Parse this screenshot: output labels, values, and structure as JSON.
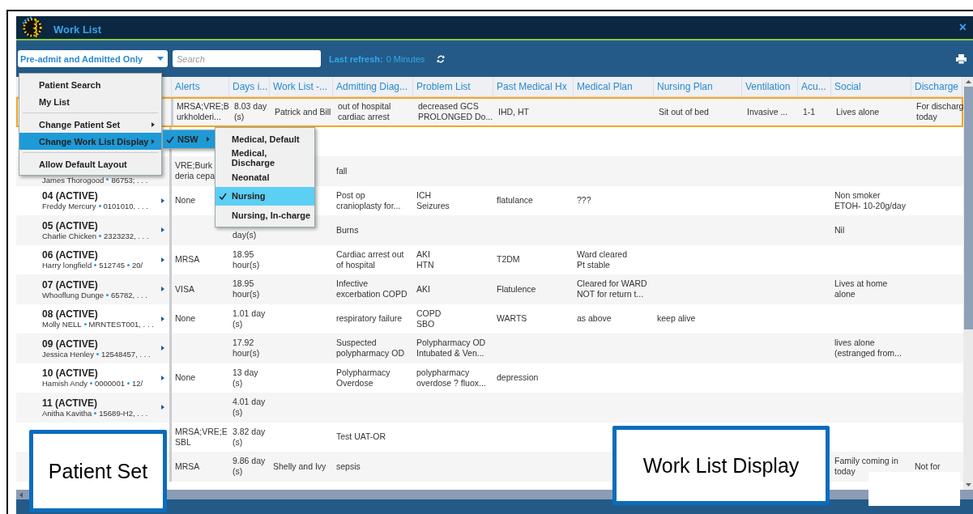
{
  "window": {
    "title": "Work List",
    "close": "×"
  },
  "toolbar": {
    "patient_filter": "Pre-admit and Admitted Only",
    "search": {
      "placeholder": "Search"
    },
    "refresh_label": "Last refresh:",
    "refresh_value": "0 Minutes"
  },
  "table": {
    "columns": [
      "Alerts",
      "Days i...",
      "Work List -...",
      "Admitting Diag...",
      "Problem List",
      "Past Medical Hx",
      "Medical Plan",
      "Nursing Plan",
      "Ventilation",
      "Acu...",
      "Social",
      "Discharge"
    ],
    "rows": [
      {
        "selected": true,
        "cells": [
          "MRSA;VRE;B\nurkholderi...",
          "8.03 day\n(s)",
          "Patrick and Bill",
          "out of hospital\ncardiac arrest",
          "decreased GCS\nPROLONGED Do...",
          "IHD, HT",
          "",
          "Sit out of bed",
          "Invasive ...",
          "1-1",
          "Lives alone",
          "For discharg\ntoday"
        ]
      },
      {
        "selected": false,
        "cells": [
          "",
          "",
          "",
          "",
          "",
          "",
          "",
          "",
          "",
          "",
          "",
          ""
        ]
      },
      {
        "selected": false,
        "patient": {
          "details": [
            "James Thorogood",
            "86753; . . ."
          ]
        },
        "cells": [
          "VRE;Burk\nderia cepa",
          "",
          "",
          "fall",
          "",
          "",
          "",
          "",
          "",
          "",
          "",
          ""
        ]
      },
      {
        "selected": false,
        "arrow": true,
        "patient": {
          "title": "04 (ACTIVE)",
          "details": [
            "Freddy Mercury",
            "0101010, . . ."
          ]
        },
        "cells": [
          "None",
          "",
          "",
          "Post op\ncranioplasty for...",
          "ICH\nSeizures",
          "flatulance",
          "???",
          "",
          "",
          "",
          "Non smoker\nETOH- 10-20g/day",
          ""
        ]
      },
      {
        "selected": false,
        "arrow": true,
        "patient": {
          "title": "05 (ACTIVE)",
          "details": [
            "Charlie Chicken",
            "2323232, . . ."
          ]
        },
        "cells": [
          "",
          "\nday(s)",
          "",
          "Burns",
          "",
          "",
          "",
          "",
          "",
          "",
          "Nil",
          ""
        ]
      },
      {
        "selected": false,
        "arrow": true,
        "patient": {
          "title": "06 (ACTIVE)",
          "details": [
            "Harry longfield",
            "512745",
            "20/"
          ]
        },
        "cells": [
          "MRSA",
          "18.95\nhour(s)",
          "",
          "Cardiac arrest out\nof hospital",
          "AKI\nHTN",
          "T2DM",
          "Ward cleared\nPt stable",
          "",
          "",
          "",
          "",
          ""
        ]
      },
      {
        "selected": false,
        "arrow": true,
        "patient": {
          "title": "07 (ACTIVE)",
          "details": [
            "Whooflung Dunge",
            "65782, . . ."
          ]
        },
        "cells": [
          "VISA",
          "18.95\nhour(s)",
          "",
          "Infective\nexcerbation COPD",
          "AKI",
          "Flatulence",
          "Cleared for WARD\nNOT for return t...",
          "",
          "",
          "",
          "Lives at home\nalone",
          ""
        ]
      },
      {
        "selected": false,
        "arrow": true,
        "patient": {
          "title": "08 (ACTIVE)",
          "details": [
            "Molly NELL",
            "MRNTEST001, . . ."
          ]
        },
        "cells": [
          "None",
          "1.01 day\n(s)",
          "",
          "respiratory failure",
          "COPD\nSBO",
          "WARTS",
          "as above",
          "keep alive",
          "",
          "",
          "",
          ""
        ]
      },
      {
        "selected": false,
        "arrow": true,
        "patient": {
          "title": "09 (ACTIVE)",
          "details": [
            "Jessica Henley",
            "12548457, . . ."
          ]
        },
        "cells": [
          "",
          "17.92\nhour(s)",
          "",
          "Suspected\npolypharmacy OD",
          "Polypharmacy OD\nIntubated & Ven...",
          "",
          "",
          "",
          "",
          "",
          "lives alone\n(estranged from...",
          ""
        ]
      },
      {
        "selected": false,
        "arrow": true,
        "patient": {
          "title": "10 (ACTIVE)",
          "details": [
            "Hamish Andy",
            "0000001",
            "12/"
          ]
        },
        "cells": [
          "None",
          "13 day\n(s)",
          "",
          "Polypharmacy\nOverdose",
          "polypharmacy\noverdose  ? fluox...",
          "depression",
          "",
          "",
          "",
          "",
          "",
          ""
        ]
      },
      {
        "selected": false,
        "arrow": true,
        "patient": {
          "title": "11 (ACTIVE)",
          "details": [
            "Anitha Kavitha",
            "15689-H2, . . ."
          ]
        },
        "cells": [
          "",
          "4.01 day\n(s)",
          "",
          "",
          "",
          "",
          "",
          "",
          "",
          "",
          "",
          ""
        ]
      },
      {
        "selected": false,
        "cells": [
          "MRSA;VRE;E\nSBL",
          "3.82 day\n(s)",
          "",
          "Test UAT-OR",
          "",
          "",
          "",
          "",
          "",
          "",
          "",
          ""
        ]
      },
      {
        "selected": false,
        "cells": [
          "MRSA",
          "9.86 day\n(s)",
          "Shelly and Ivy",
          "sepsis",
          "",
          "",
          "",
          "",
          "",
          "",
          "Family coming in\ntoday",
          "Not for"
        ]
      }
    ]
  },
  "context_menu": {
    "items": [
      {
        "kind": "item",
        "label": "Patient Search",
        "submenu": false,
        "selected": false
      },
      {
        "kind": "item",
        "label": "My List",
        "submenu": false,
        "selected": false
      },
      {
        "kind": "separator"
      },
      {
        "kind": "item",
        "label": "Change Patient Set",
        "submenu": true,
        "selected": false
      },
      {
        "kind": "item",
        "label": "Change Work List Display",
        "submenu": true,
        "selected": true
      },
      {
        "kind": "separator"
      },
      {
        "kind": "item",
        "label": "Allow Default Layout",
        "submenu": false,
        "selected": false
      }
    ]
  },
  "display_submenu": {
    "items": [
      {
        "label": "NSW",
        "checked": true,
        "selected": true,
        "submenu": true
      }
    ]
  },
  "layout_submenu": {
    "items": [
      {
        "label": "Medical, Default",
        "checked": false,
        "selected": false
      },
      {
        "label": "Medical, Discharge",
        "checked": false,
        "selected": false
      },
      {
        "label": "Neonatal",
        "checked": false,
        "selected": false
      },
      {
        "label": "Nursing",
        "checked": true,
        "selected": true
      },
      {
        "label": "Nursing, In-charge",
        "checked": false,
        "selected": false
      }
    ]
  },
  "callouts": [
    {
      "text": "Patient Set"
    },
    {
      "text": "Work List Display"
    }
  ]
}
